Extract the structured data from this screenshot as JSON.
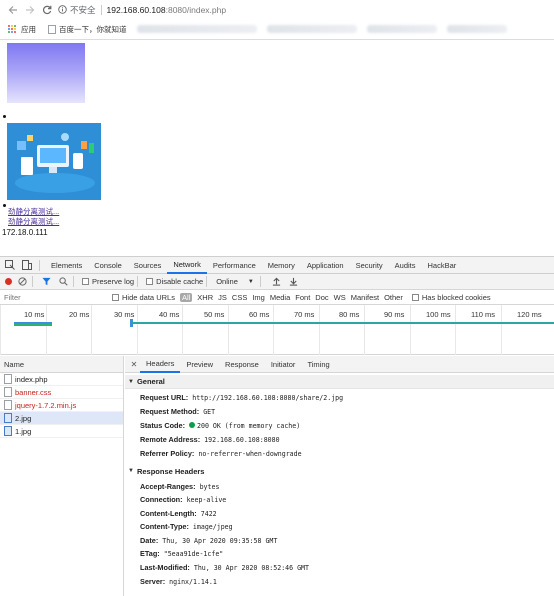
{
  "browser": {
    "url_insecure_label": "不安全",
    "url_host": "192.168.60.108",
    "url_path": ":8080/index.php",
    "bookmarks": [
      {
        "label": "应用",
        "icon": "apps-grid-icon"
      },
      {
        "label": "百度一下，你就知道",
        "icon": "page-icon"
      }
    ]
  },
  "page": {
    "links": [
      "劲静分离测试...",
      "劲静分离测试..."
    ],
    "ip_text": "172.18.0.111"
  },
  "devtools": {
    "tabs": [
      "Elements",
      "Console",
      "Sources",
      "Network",
      "Performance",
      "Memory",
      "Application",
      "Security",
      "Audits",
      "HackBar"
    ],
    "active_tab": "Network",
    "toolbar": {
      "preserve_log": "Preserve log",
      "disable_cache": "Disable cache",
      "throttle": "Online"
    },
    "filter": {
      "placeholder": "Filter",
      "hide_data_urls": "Hide data URLs",
      "types": [
        "All",
        "XHR",
        "JS",
        "CSS",
        "Img",
        "Media",
        "Font",
        "Doc",
        "WS",
        "Manifest",
        "Other"
      ],
      "has_blocked_cookies": "Has blocked cookies"
    },
    "timeline_labels": [
      "10 ms",
      "20 ms",
      "30 ms",
      "40 ms",
      "50 ms",
      "60 ms",
      "70 ms",
      "80 ms",
      "90 ms",
      "100 ms",
      "110 ms",
      "120 ms"
    ],
    "requests": {
      "header": "Name",
      "items": [
        {
          "name": "index.php",
          "type": "doc",
          "color": "#222222"
        },
        {
          "name": "banner.css",
          "type": "doc",
          "color": "#c5221f"
        },
        {
          "name": "jquery-1.7.2.min.js",
          "type": "doc",
          "color": "#c5221f"
        },
        {
          "name": "2.jpg",
          "type": "img",
          "color": "#222222"
        },
        {
          "name": "1.jpg",
          "type": "img",
          "color": "#222222"
        }
      ]
    },
    "detail": {
      "tabs": [
        "Headers",
        "Preview",
        "Response",
        "Initiator",
        "Timing"
      ],
      "active_tab": "Headers",
      "general_title": "General",
      "general": [
        {
          "key": "Request URL:",
          "value": "http://192.168.60.108:8080/share/2.jpg"
        },
        {
          "key": "Request Method:",
          "value": "GET"
        },
        {
          "key": "Status Code:",
          "value": "200 OK (from memory cache)"
        },
        {
          "key": "Remote Address:",
          "value": "192.168.60.108:8080"
        },
        {
          "key": "Referrer Policy:",
          "value": "no-referrer-when-downgrade"
        }
      ],
      "response_title": "Response Headers",
      "response_headers": [
        {
          "key": "Accept-Ranges:",
          "value": "bytes"
        },
        {
          "key": "Connection:",
          "value": "keep-alive"
        },
        {
          "key": "Content-Length:",
          "value": "7422"
        },
        {
          "key": "Content-Type:",
          "value": "image/jpeg"
        },
        {
          "key": "Date:",
          "value": "Thu, 30 Apr 2020 09:35:58 GMT"
        },
        {
          "key": "ETag:",
          "value": "\"5eaa91de-1cfe\""
        },
        {
          "key": "Last-Modified:",
          "value": "Thu, 30 Apr 2020 08:52:46 GMT"
        },
        {
          "key": "Server:",
          "value": "nginx/1.14.1"
        }
      ]
    }
  }
}
